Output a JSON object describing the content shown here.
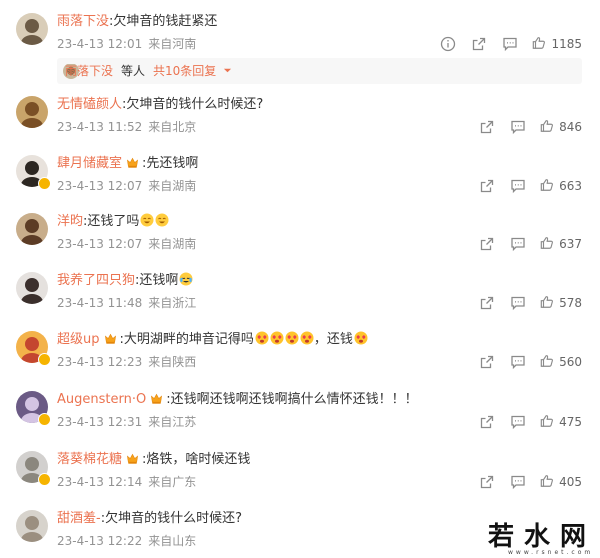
{
  "comments": [
    {
      "user": "雨落下没",
      "sep": ":",
      "text": "欠坤音的钱赶紧还",
      "emojis": [],
      "date": "23-4-13 12:01",
      "location": "来自河南",
      "likes": "1185",
      "crown": false,
      "vip": false,
      "report": true
    },
    {
      "user": "无情磕颜人",
      "sep": ":",
      "text": "欠坤音的钱什么时候还?",
      "emojis": [],
      "date": "23-4-13 11:52",
      "location": "来自北京",
      "likes": "846",
      "crown": false,
      "vip": false,
      "report": false
    },
    {
      "user": "肆月储藏室",
      "sep": ":",
      "text": "先还钱啊",
      "emojis": [],
      "date": "23-4-13 12:07",
      "location": "来自湖南",
      "likes": "663",
      "crown": true,
      "vip": true,
      "report": false
    },
    {
      "user": "洋昀",
      "sep": ":",
      "text": "还钱了吗",
      "emojis": [
        "emoji-grin",
        "emoji-grin"
      ],
      "date": "23-4-13 12:07",
      "location": "来自湖南",
      "likes": "637",
      "crown": false,
      "vip": false,
      "report": false
    },
    {
      "user": "我养了四只狗",
      "sep": ":",
      "text": "还钱啊",
      "emojis": [
        "emoji-cry"
      ],
      "date": "23-4-13 11:48",
      "location": "来自浙江",
      "likes": "578",
      "crown": false,
      "vip": false,
      "report": false
    },
    {
      "user": "超级up",
      "sep": ":",
      "text": "大明湖畔的坤音记得吗",
      "emojis": [
        "emoji-love",
        "emoji-love",
        "emoji-love",
        "emoji-love"
      ],
      "text2": "，还钱",
      "emojis2": [
        "emoji-love"
      ],
      "date": "23-4-13 12:23",
      "location": "来自陕西",
      "likes": "560",
      "crown": true,
      "vip": true,
      "report": false
    },
    {
      "user": "Augenstern·O",
      "sep": ":",
      "text": "还钱啊还钱啊还钱啊搞什么情怀还钱！！！",
      "emojis": [],
      "date": "23-4-13 12:31",
      "location": "来自江苏",
      "likes": "475",
      "crown": true,
      "vip": true,
      "report": false
    },
    {
      "user": "落葵棉花糖",
      "sep": ":",
      "text": "烙铁，啥时候还钱",
      "emojis": [],
      "date": "23-4-13 12:14",
      "location": "来自广东",
      "likes": "405",
      "crown": true,
      "vip": true,
      "report": false
    },
    {
      "user": "甜酒羞-",
      "sep": ":",
      "text": "欠坤音的钱什么时候还?",
      "emojis": [],
      "date": "23-4-13 12:22",
      "location": "来自山东",
      "likes": "",
      "crown": false,
      "vip": false,
      "report": false
    }
  ],
  "replies_bar": {
    "user": "雨落下没",
    "middle": "等人",
    "link": "共10条回复"
  },
  "watermark": {
    "main": "若水网",
    "sub": "www.rsnet.com"
  },
  "colors": {
    "username": "#eb7350",
    "meta": "#939393",
    "text": "#333333",
    "badge": "#f6b400"
  },
  "icons": [
    "info-icon",
    "share-icon",
    "comment-icon",
    "like-icon",
    "crown-icon",
    "chevron-down-icon"
  ]
}
